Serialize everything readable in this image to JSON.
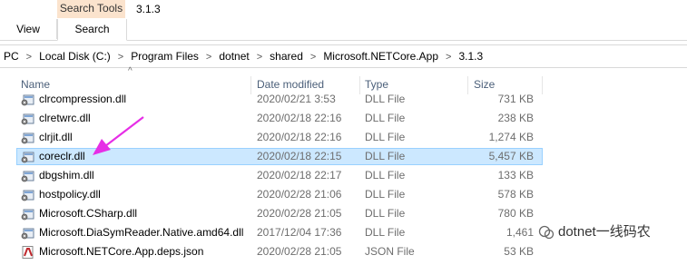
{
  "ribbon": {
    "tool_header": "Search Tools",
    "title": "3.1.3",
    "tabs": [
      {
        "label": "View"
      },
      {
        "label": "Search"
      }
    ]
  },
  "address": {
    "crumbs": [
      "PC",
      "Local Disk (C:)",
      "Program Files",
      "dotnet",
      "shared",
      "Microsoft.NETCore.App",
      "3.1.3"
    ],
    "separator": ">"
  },
  "columns": {
    "name": "Name",
    "date": "Date modified",
    "type": "Type",
    "size": "Size",
    "sort_indicator": "^"
  },
  "files": [
    {
      "name": "clrcompression.dll",
      "date": "2020/02/21 3:53",
      "type": "DLL File",
      "size": "731 KB",
      "icon": "dll-file-icon"
    },
    {
      "name": "clretwrc.dll",
      "date": "2020/02/18 22:16",
      "type": "DLL File",
      "size": "238 KB",
      "icon": "dll-file-icon"
    },
    {
      "name": "clrjit.dll",
      "date": "2020/02/18 22:16",
      "type": "DLL File",
      "size": "1,274 KB",
      "icon": "dll-file-icon"
    },
    {
      "name": "coreclr.dll",
      "date": "2020/02/18 22:15",
      "type": "DLL File",
      "size": "5,457 KB",
      "icon": "dll-file-icon",
      "selected": true
    },
    {
      "name": "dbgshim.dll",
      "date": "2020/02/18 22:17",
      "type": "DLL File",
      "size": "133 KB",
      "icon": "dll-file-icon"
    },
    {
      "name": "hostpolicy.dll",
      "date": "2020/02/28 21:06",
      "type": "DLL File",
      "size": "578 KB",
      "icon": "dll-file-icon"
    },
    {
      "name": "Microsoft.CSharp.dll",
      "date": "2020/02/28 21:05",
      "type": "DLL File",
      "size": "780 KB",
      "icon": "dll-file-icon"
    },
    {
      "name": "Microsoft.DiaSymReader.Native.amd64.dll",
      "date": "2017/12/04 17:36",
      "type": "DLL File",
      "size": "1,461",
      "icon": "dll-file-icon"
    },
    {
      "name": "Microsoft.NETCore.App.deps.json",
      "date": "2020/02/28 21:05",
      "type": "JSON File",
      "size": "53 KB",
      "icon": "json-file-icon"
    }
  ],
  "watermark": {
    "text": "dotnet一线码农"
  },
  "colors": {
    "selection_bg": "#cce8ff",
    "selection_border": "#99d1ff",
    "tool_header_bg": "#fbe3cd",
    "annotation_arrow": "#e62ee6"
  }
}
